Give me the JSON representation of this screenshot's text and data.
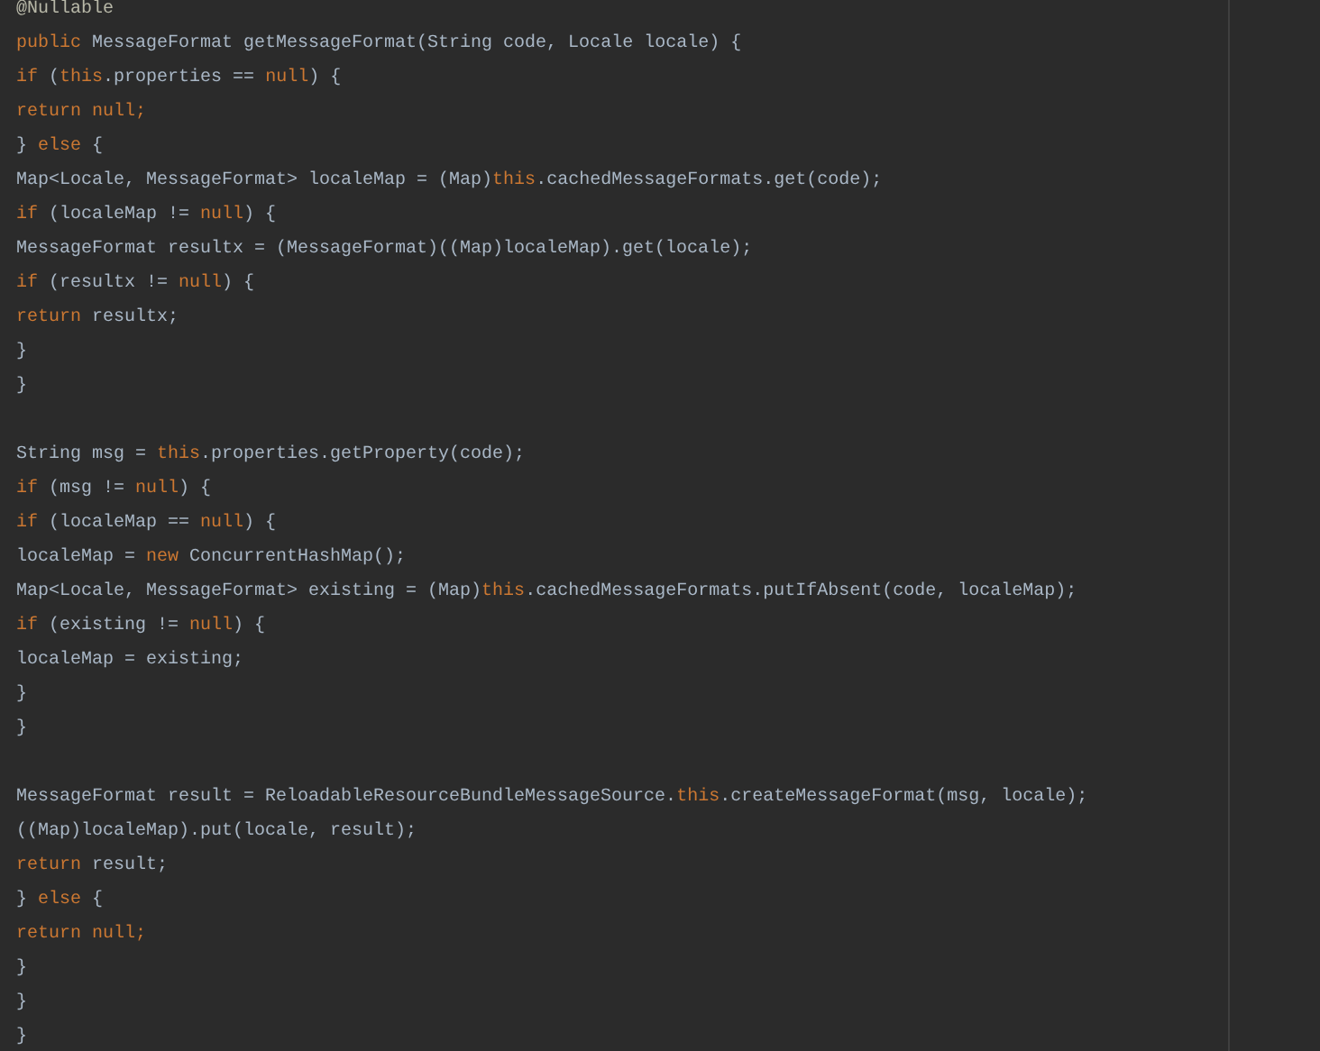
{
  "editor": {
    "lines": [
      {
        "kind": "code",
        "tokens": [
          {
            "kind": "annotation",
            "text": "@Nullable"
          }
        ]
      },
      {
        "kind": "code",
        "tokens": [
          {
            "kind": "keyword",
            "text": "public"
          },
          {
            "kind": "plain",
            "text": " MessageFormat getMessageFormat(String code, Locale locale) {"
          }
        ]
      },
      {
        "kind": "code",
        "tokens": [
          {
            "kind": "keyword",
            "text": "    if"
          },
          {
            "kind": "plain",
            "text": " ("
          },
          {
            "kind": "keyword",
            "text": "this"
          },
          {
            "kind": "plain",
            "text": ".properties == "
          },
          {
            "kind": "keyword",
            "text": "null"
          },
          {
            "kind": "plain",
            "text": ") {"
          }
        ]
      },
      {
        "kind": "code",
        "tokens": [
          {
            "kind": "keyword",
            "text": "        return null;"
          }
        ]
      },
      {
        "kind": "code",
        "tokens": [
          {
            "kind": "plain",
            "text": "    } "
          },
          {
            "kind": "keyword",
            "text": "else"
          },
          {
            "kind": "plain",
            "text": " {"
          }
        ]
      },
      {
        "kind": "code",
        "tokens": [
          {
            "kind": "plain",
            "text": "        Map<Locale, MessageFormat> localeMap = (Map)"
          },
          {
            "kind": "keyword",
            "text": "this"
          },
          {
            "kind": "plain",
            "text": ".cachedMessageFormats.get(code);"
          }
        ]
      },
      {
        "kind": "code",
        "tokens": [
          {
            "kind": "keyword",
            "text": "        if"
          },
          {
            "kind": "plain",
            "text": " (localeMap != "
          },
          {
            "kind": "keyword",
            "text": "null"
          },
          {
            "kind": "plain",
            "text": ") {"
          }
        ]
      },
      {
        "kind": "code",
        "tokens": [
          {
            "kind": "plain",
            "text": "            MessageFormat resultx = (MessageFormat)((Map)localeMap).get(locale);"
          }
        ]
      },
      {
        "kind": "code",
        "tokens": [
          {
            "kind": "keyword",
            "text": "            if"
          },
          {
            "kind": "plain",
            "text": " (resultx != "
          },
          {
            "kind": "keyword",
            "text": "null"
          },
          {
            "kind": "plain",
            "text": ") {"
          }
        ]
      },
      {
        "kind": "code",
        "tokens": [
          {
            "kind": "keyword",
            "text": "                return"
          },
          {
            "kind": "plain",
            "text": " resultx;"
          }
        ]
      },
      {
        "kind": "code",
        "tokens": [
          {
            "kind": "plain",
            "text": "            }"
          }
        ]
      },
      {
        "kind": "code",
        "tokens": [
          {
            "kind": "plain",
            "text": "        }"
          }
        ]
      },
      {
        "kind": "blank"
      },
      {
        "kind": "code",
        "tokens": [
          {
            "kind": "plain",
            "text": "        String msg = "
          },
          {
            "kind": "keyword",
            "text": "this"
          },
          {
            "kind": "plain",
            "text": ".properties.getProperty(code);"
          }
        ]
      },
      {
        "kind": "code",
        "tokens": [
          {
            "kind": "keyword",
            "text": "        if"
          },
          {
            "kind": "plain",
            "text": " (msg != "
          },
          {
            "kind": "keyword",
            "text": "null"
          },
          {
            "kind": "plain",
            "text": ") {"
          }
        ]
      },
      {
        "kind": "code",
        "tokens": [
          {
            "kind": "keyword",
            "text": "            if"
          },
          {
            "kind": "plain",
            "text": " (localeMap == "
          },
          {
            "kind": "keyword",
            "text": "null"
          },
          {
            "kind": "plain",
            "text": ") {"
          }
        ]
      },
      {
        "kind": "code",
        "tokens": [
          {
            "kind": "plain",
            "text": "                localeMap = "
          },
          {
            "kind": "keyword",
            "text": "new"
          },
          {
            "kind": "plain",
            "text": " ConcurrentHashMap();"
          }
        ]
      },
      {
        "kind": "code",
        "tokens": [
          {
            "kind": "plain",
            "text": "                Map<Locale, MessageFormat> existing = (Map)"
          },
          {
            "kind": "keyword",
            "text": "this"
          },
          {
            "kind": "plain",
            "text": ".cachedMessageFormats.putIfAbsent(code, localeMap);"
          }
        ]
      },
      {
        "kind": "code",
        "tokens": [
          {
            "kind": "keyword",
            "text": "                if"
          },
          {
            "kind": "plain",
            "text": " (existing != "
          },
          {
            "kind": "keyword",
            "text": "null"
          },
          {
            "kind": "plain",
            "text": ") {"
          }
        ]
      },
      {
        "kind": "code",
        "tokens": [
          {
            "kind": "plain",
            "text": "                    localeMap = existing;"
          }
        ]
      },
      {
        "kind": "code",
        "tokens": [
          {
            "kind": "plain",
            "text": "                }"
          }
        ]
      },
      {
        "kind": "code",
        "tokens": [
          {
            "kind": "plain",
            "text": "            }"
          }
        ]
      },
      {
        "kind": "blank"
      },
      {
        "kind": "code",
        "tokens": [
          {
            "kind": "plain",
            "text": "            MessageFormat result = ReloadableResourceBundleMessageSource."
          },
          {
            "kind": "keyword",
            "text": "this"
          },
          {
            "kind": "plain",
            "text": ".createMessageFormat(msg, locale);"
          }
        ]
      },
      {
        "kind": "code",
        "tokens": [
          {
            "kind": "plain",
            "text": "            ((Map)localeMap).put(locale, result);"
          }
        ]
      },
      {
        "kind": "code",
        "tokens": [
          {
            "kind": "keyword",
            "text": "            return"
          },
          {
            "kind": "plain",
            "text": " result;"
          }
        ]
      },
      {
        "kind": "code",
        "tokens": [
          {
            "kind": "plain",
            "text": "        } "
          },
          {
            "kind": "keyword",
            "text": "else"
          },
          {
            "kind": "plain",
            "text": " {"
          }
        ]
      },
      {
        "kind": "code",
        "tokens": [
          {
            "kind": "keyword",
            "text": "            return null;"
          }
        ]
      },
      {
        "kind": "code",
        "tokens": [
          {
            "kind": "plain",
            "text": "        }"
          }
        ]
      },
      {
        "kind": "code",
        "tokens": [
          {
            "kind": "plain",
            "text": "    }"
          }
        ]
      },
      {
        "kind": "code",
        "tokens": [
          {
            "kind": "plain",
            "text": "}"
          }
        ]
      }
    ]
  }
}
